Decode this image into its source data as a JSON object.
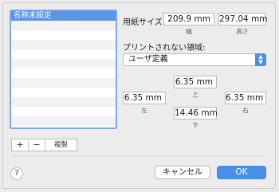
{
  "presets": {
    "items": [
      "名称未設定",
      "",
      "",
      "",
      "",
      "",
      "",
      "",
      "",
      "",
      "",
      ""
    ],
    "add_label": "+",
    "remove_label": "−",
    "duplicate_label": "複製"
  },
  "paper_size": {
    "label": "用紙サイズ:",
    "width_value": "209.9 mm",
    "width_caption": "幅",
    "height_value": "297.04 mm",
    "height_caption": "高さ"
  },
  "non_printable": {
    "label": "プリントされない領域:",
    "selected_option": "ユーザ定義",
    "top_value": "6.35 mm",
    "top_caption": "上",
    "left_value": "6.35 mm",
    "left_caption": "左",
    "right_value": "6.35 mm",
    "right_caption": "右",
    "bottom_value": "14.46 mm",
    "bottom_caption": "下"
  },
  "footer": {
    "help_label": "?",
    "cancel_label": "キャンセル",
    "ok_label": "OK"
  },
  "colors": {
    "accent": "#4a8fe7",
    "selection": "#5b95e8"
  }
}
